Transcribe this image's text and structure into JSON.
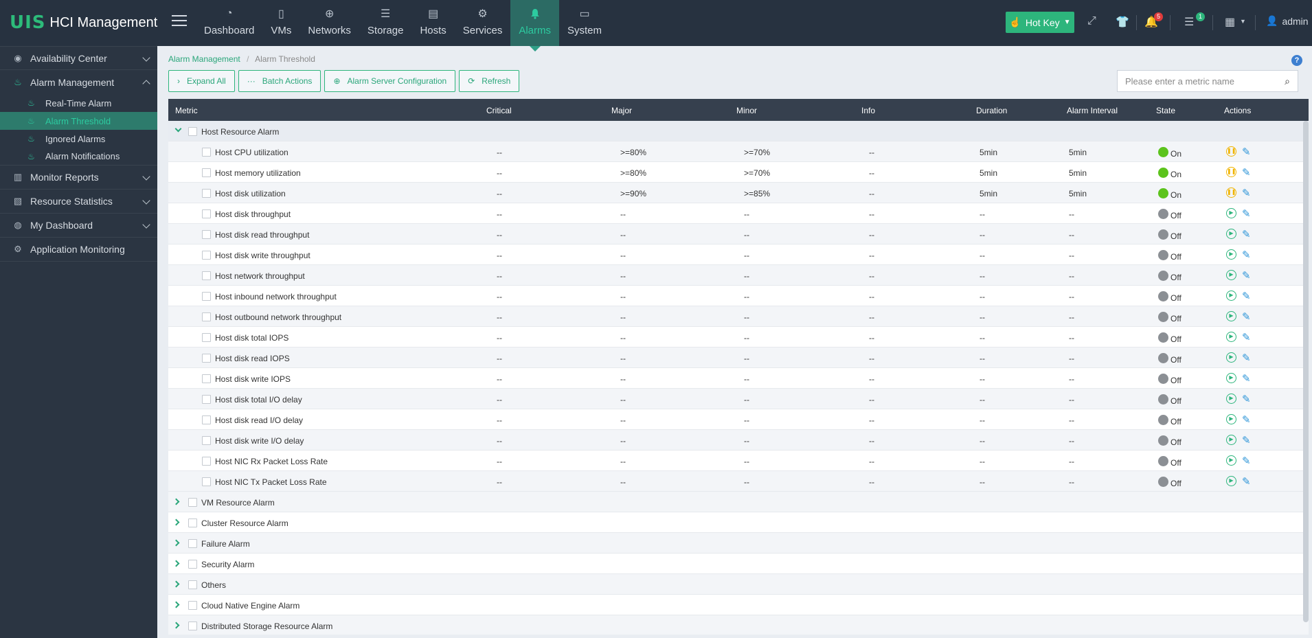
{
  "app": {
    "logo_mark": "UIS",
    "title": "HCI Management"
  },
  "nav": [
    {
      "label": "Dashboard",
      "icon": "gauge-icon",
      "glyph": "◔"
    },
    {
      "label": "VMs",
      "icon": "vm-icon",
      "glyph": "▯"
    },
    {
      "label": "Networks",
      "icon": "globe-icon",
      "glyph": "⊕"
    },
    {
      "label": "Storage",
      "icon": "database-icon",
      "glyph": "☰"
    },
    {
      "label": "Hosts",
      "icon": "server-icon",
      "glyph": "▤"
    },
    {
      "label": "Services",
      "icon": "gear-icon",
      "glyph": "⚙"
    },
    {
      "label": "Alarms",
      "icon": "bell-icon",
      "glyph": "🔔"
    },
    {
      "label": "System",
      "icon": "monitor-icon",
      "glyph": "▭"
    }
  ],
  "topbar": {
    "hotkey_label": "Hot Key",
    "notifications_count": "5",
    "tasks_count": "1",
    "user": "admin",
    "badge_red": "#e03b3b",
    "badge_green": "#2db57c"
  },
  "sidebar": {
    "sections": [
      {
        "label": "Availability Center",
        "icon": "availability-icon"
      },
      {
        "label": "Alarm Management",
        "icon": "alarm-icon"
      },
      {
        "label": "Monitor Reports",
        "icon": "report-icon"
      },
      {
        "label": "Resource Statistics",
        "icon": "statistics-icon"
      },
      {
        "label": "My Dashboard",
        "icon": "dashboard-icon"
      },
      {
        "label": "Application Monitoring",
        "icon": "app-monitor-icon"
      }
    ],
    "alarm_subitems": [
      {
        "label": "Real-Time Alarm"
      },
      {
        "label": "Alarm Threshold"
      },
      {
        "label": "Ignored Alarms"
      },
      {
        "label": "Alarm Notifications"
      }
    ]
  },
  "breadcrumb": {
    "parent": "Alarm Management",
    "current": "Alarm Threshold"
  },
  "toolbar": {
    "expand_all": "Expand All",
    "batch_actions": "Batch Actions",
    "alarm_server_config": "Alarm Server Configuration",
    "refresh": "Refresh"
  },
  "search": {
    "placeholder": "Please enter a metric name"
  },
  "table": {
    "headers": {
      "metric": "Metric",
      "critical": "Critical",
      "major": "Major",
      "minor": "Minor",
      "info": "Info",
      "duration": "Duration",
      "interval": "Alarm Interval",
      "state": "State",
      "actions": "Actions"
    },
    "expanded_group": "Host Resource Alarm",
    "rows": [
      {
        "metric": "Host CPU utilization",
        "critical": "--",
        "major": ">=80%",
        "minor": ">=70%",
        "info": "--",
        "duration": "5min",
        "interval": "5min",
        "state": "On"
      },
      {
        "metric": "Host memory utilization",
        "critical": "--",
        "major": ">=80%",
        "minor": ">=70%",
        "info": "--",
        "duration": "5min",
        "interval": "5min",
        "state": "On"
      },
      {
        "metric": "Host disk utilization",
        "critical": "--",
        "major": ">=90%",
        "minor": ">=85%",
        "info": "--",
        "duration": "5min",
        "interval": "5min",
        "state": "On"
      },
      {
        "metric": "Host disk throughput",
        "critical": "--",
        "major": "--",
        "minor": "--",
        "info": "--",
        "duration": "--",
        "interval": "--",
        "state": "Off"
      },
      {
        "metric": "Host disk read throughput",
        "critical": "--",
        "major": "--",
        "minor": "--",
        "info": "--",
        "duration": "--",
        "interval": "--",
        "state": "Off"
      },
      {
        "metric": "Host disk write throughput",
        "critical": "--",
        "major": "--",
        "minor": "--",
        "info": "--",
        "duration": "--",
        "interval": "--",
        "state": "Off"
      },
      {
        "metric": "Host network throughput",
        "critical": "--",
        "major": "--",
        "minor": "--",
        "info": "--",
        "duration": "--",
        "interval": "--",
        "state": "Off"
      },
      {
        "metric": "Host inbound network throughput",
        "critical": "--",
        "major": "--",
        "minor": "--",
        "info": "--",
        "duration": "--",
        "interval": "--",
        "state": "Off"
      },
      {
        "metric": "Host outbound network throughput",
        "critical": "--",
        "major": "--",
        "minor": "--",
        "info": "--",
        "duration": "--",
        "interval": "--",
        "state": "Off"
      },
      {
        "metric": "Host disk total IOPS",
        "critical": "--",
        "major": "--",
        "minor": "--",
        "info": "--",
        "duration": "--",
        "interval": "--",
        "state": "Off"
      },
      {
        "metric": "Host disk read IOPS",
        "critical": "--",
        "major": "--",
        "minor": "--",
        "info": "--",
        "duration": "--",
        "interval": "--",
        "state": "Off"
      },
      {
        "metric": "Host disk write IOPS",
        "critical": "--",
        "major": "--",
        "minor": "--",
        "info": "--",
        "duration": "--",
        "interval": "--",
        "state": "Off"
      },
      {
        "metric": "Host disk total I/O delay",
        "critical": "--",
        "major": "--",
        "minor": "--",
        "info": "--",
        "duration": "--",
        "interval": "--",
        "state": "Off"
      },
      {
        "metric": "Host disk read I/O delay",
        "critical": "--",
        "major": "--",
        "minor": "--",
        "info": "--",
        "duration": "--",
        "interval": "--",
        "state": "Off"
      },
      {
        "metric": "Host disk write I/O delay",
        "critical": "--",
        "major": "--",
        "minor": "--",
        "info": "--",
        "duration": "--",
        "interval": "--",
        "state": "Off"
      },
      {
        "metric": "Host NIC Rx Packet Loss Rate",
        "critical": "--",
        "major": "--",
        "minor": "--",
        "info": "--",
        "duration": "--",
        "interval": "--",
        "state": "Off"
      },
      {
        "metric": "Host NIC Tx Packet Loss Rate",
        "critical": "--",
        "major": "--",
        "minor": "--",
        "info": "--",
        "duration": "--",
        "interval": "--",
        "state": "Off"
      }
    ],
    "collapsed_groups": [
      "VM Resource Alarm",
      "Cluster Resource Alarm",
      "Failure Alarm",
      "Security Alarm",
      "Others",
      "Cloud Native Engine Alarm",
      "Distributed Storage Resource Alarm"
    ]
  },
  "colors": {
    "accent": "#2db57c",
    "state_on": "#5cc31c",
    "state_off": "#8b8f94",
    "pause": "#f0b400",
    "play": "#2db57c",
    "edit": "#2d95d8"
  }
}
